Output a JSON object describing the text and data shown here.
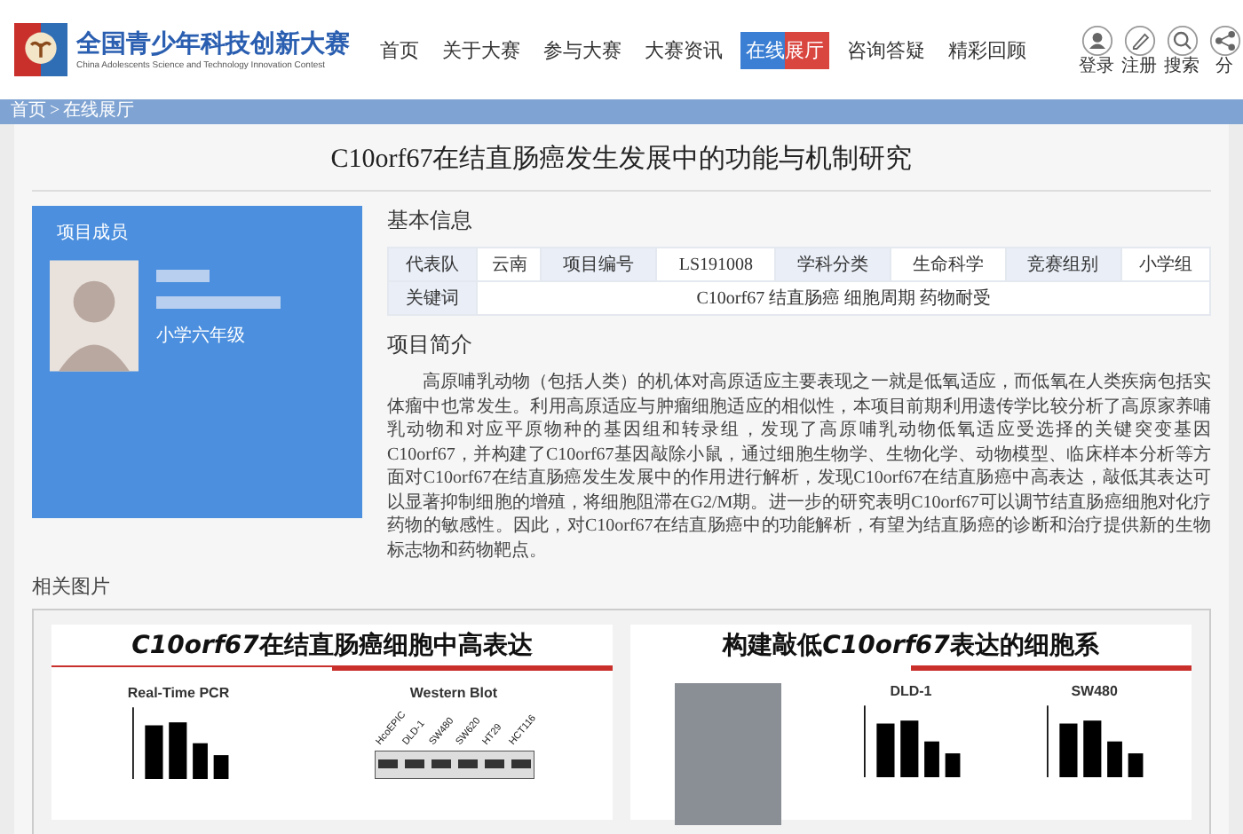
{
  "header": {
    "logo_title": "全国青少年科技创新大赛",
    "logo_subtitle": "China Adolescents Science and Technology Innovation Contest"
  },
  "nav": [
    {
      "label": "首页",
      "selected": false
    },
    {
      "label": "关于大赛",
      "selected": false
    },
    {
      "label": "参与大赛",
      "selected": false
    },
    {
      "label": "大赛资讯",
      "selected": false
    },
    {
      "label": "在线展厅",
      "selected": true
    },
    {
      "label": "咨询答疑",
      "selected": false
    },
    {
      "label": "精彩回顾",
      "selected": false
    }
  ],
  "user_actions": [
    {
      "kind": "user",
      "label": "登录"
    },
    {
      "kind": "pen",
      "label": "注册"
    },
    {
      "kind": "search",
      "label": "搜索"
    },
    {
      "kind": "share",
      "label": "分"
    }
  ],
  "breadcrumb": {
    "items": [
      "首页",
      "在线展厅"
    ],
    "separator": ">"
  },
  "project": {
    "title": "C10orf67在结直肠癌发生发展中的功能与机制研究",
    "member_card": {
      "heading": "项目成员",
      "grade": "小学六年级"
    },
    "basic_info": {
      "heading": "基本信息",
      "fields": [
        {
          "label": "代表队",
          "value": "云南"
        },
        {
          "label": "项目编号",
          "value": "LS191008"
        },
        {
          "label": "学科分类",
          "value": "生命科学"
        },
        {
          "label": "竞赛组别",
          "value": "小学组"
        }
      ],
      "keywords": {
        "label": "关键词",
        "value": "C10orf67 结直肠癌 细胞周期 药物耐受"
      }
    },
    "summary": {
      "heading": "项目简介",
      "text": "高原哺乳动物（包括人类）的机体对高原适应主要表现之一就是低氧适应，而低氧在人类疾病包括实体瘤中也常发生。利用高原适应与肿瘤细胞适应的相似性，本项目前期利用遗传学比较分析了高原家养哺乳动物和对应平原物种的基因组和转录组，发现了高原哺乳动物低氧适应受选择的关键突变基因C10orf67，并构建了C10orf67基因敲除小鼠，通过细胞生物学、生物化学、动物模型、临床样本分析等方面对C10orf67在结直肠癌发生发展中的作用进行解析，发现C10orf67在结直肠癌中高表达，敲低其表达可以显著抑制细胞的增殖，将细胞阻滞在G2/M期。进一步的研究表明C10orf67可以调节结直肠癌细胞对化疗药物的敏感性。因此，对C10orf67在结直肠癌中的功能解析，有望为结直肠癌的诊断和治疗提供新的生物标志物和药物靶点。"
    }
  },
  "gallery": {
    "heading": "相关图片",
    "slides": [
      {
        "title": [
          {
            "text": "C10orf67",
            "italic": true
          },
          {
            "text": "在结直肠癌细胞中高表达",
            "italic": false
          }
        ],
        "panels": [
          {
            "kind": "bars",
            "label": "Real-Time PCR"
          },
          {
            "kind": "blot",
            "label": "Western Blot",
            "lanes": [
              "HcoEPIC",
              "DLD-1",
              "SW480",
              "SW620",
              "HT29",
              "HCT116"
            ]
          }
        ]
      },
      {
        "title": [
          {
            "text": "构建敲低",
            "italic": false
          },
          {
            "text": "C10orf67",
            "italic": true
          },
          {
            "text": "表达的细胞系",
            "italic": false
          }
        ],
        "panels": [
          {
            "kind": "photo"
          },
          {
            "kind": "bars",
            "label": "DLD-1"
          },
          {
            "kind": "bars",
            "label": "SW480"
          }
        ]
      }
    ]
  }
}
